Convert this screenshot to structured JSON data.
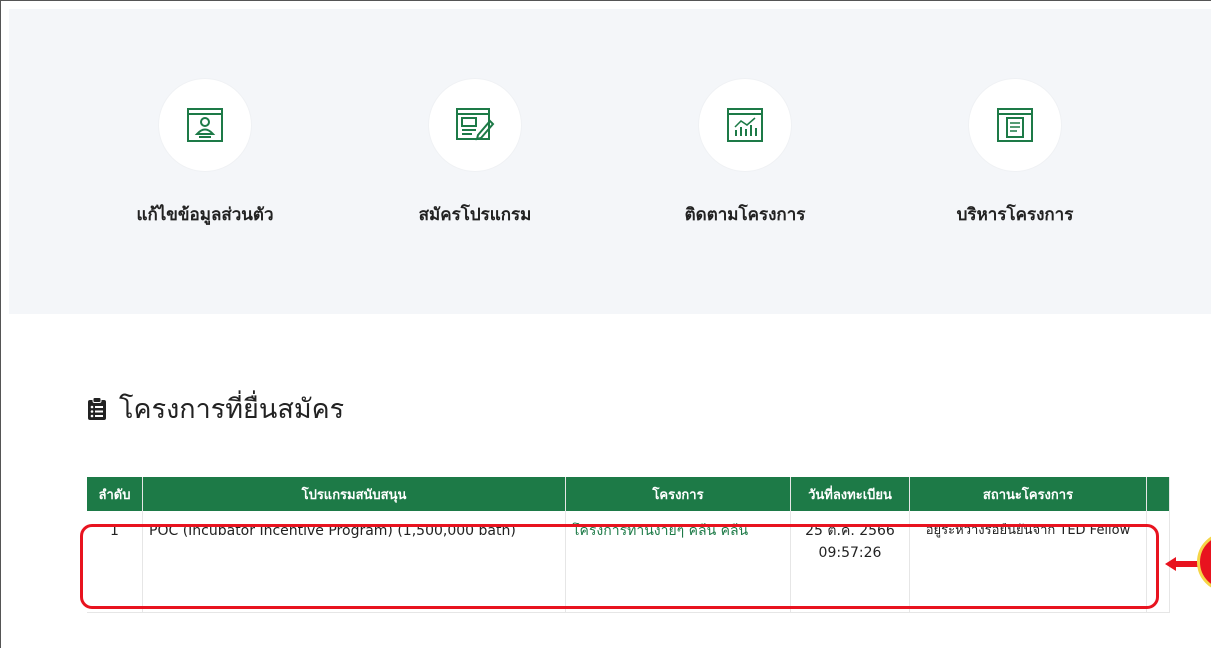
{
  "menu": {
    "items": [
      {
        "label": "แก้ไขข้อมูลส่วนตัว",
        "icon": "profile-card-icon"
      },
      {
        "label": "สมัครโปรแกรม",
        "icon": "application-form-icon"
      },
      {
        "label": "ติดตามโครงการ",
        "icon": "tracking-chart-icon"
      },
      {
        "label": "บริหารโครงการ",
        "icon": "project-management-icon"
      }
    ]
  },
  "section": {
    "title": "โครงการที่ยื่นสมัคร",
    "icon": "clipboard-list-icon"
  },
  "table": {
    "headers": [
      "ลำดับ",
      "โปรแกรมสนับสนุน",
      "โครงการ",
      "วันที่ลงทะเบียน",
      "สถานะโครงการ"
    ],
    "rows": [
      {
        "no": "1",
        "program": "POC (Incubator Incentive Program) (1,500,000 bath)",
        "project": "โครงการทานง่ายๆ คลีน คลีน",
        "date": "25 ต.ค. 2566 09:57:26",
        "status": "อยู่ระหว่างรอยืนยันจาก TED Fellow"
      }
    ]
  },
  "colors": {
    "primary_green": "#1d7a47",
    "menu_background": "#f4f6f9",
    "annotation_red": "#e8131f",
    "callout_border": "#f5d547"
  }
}
